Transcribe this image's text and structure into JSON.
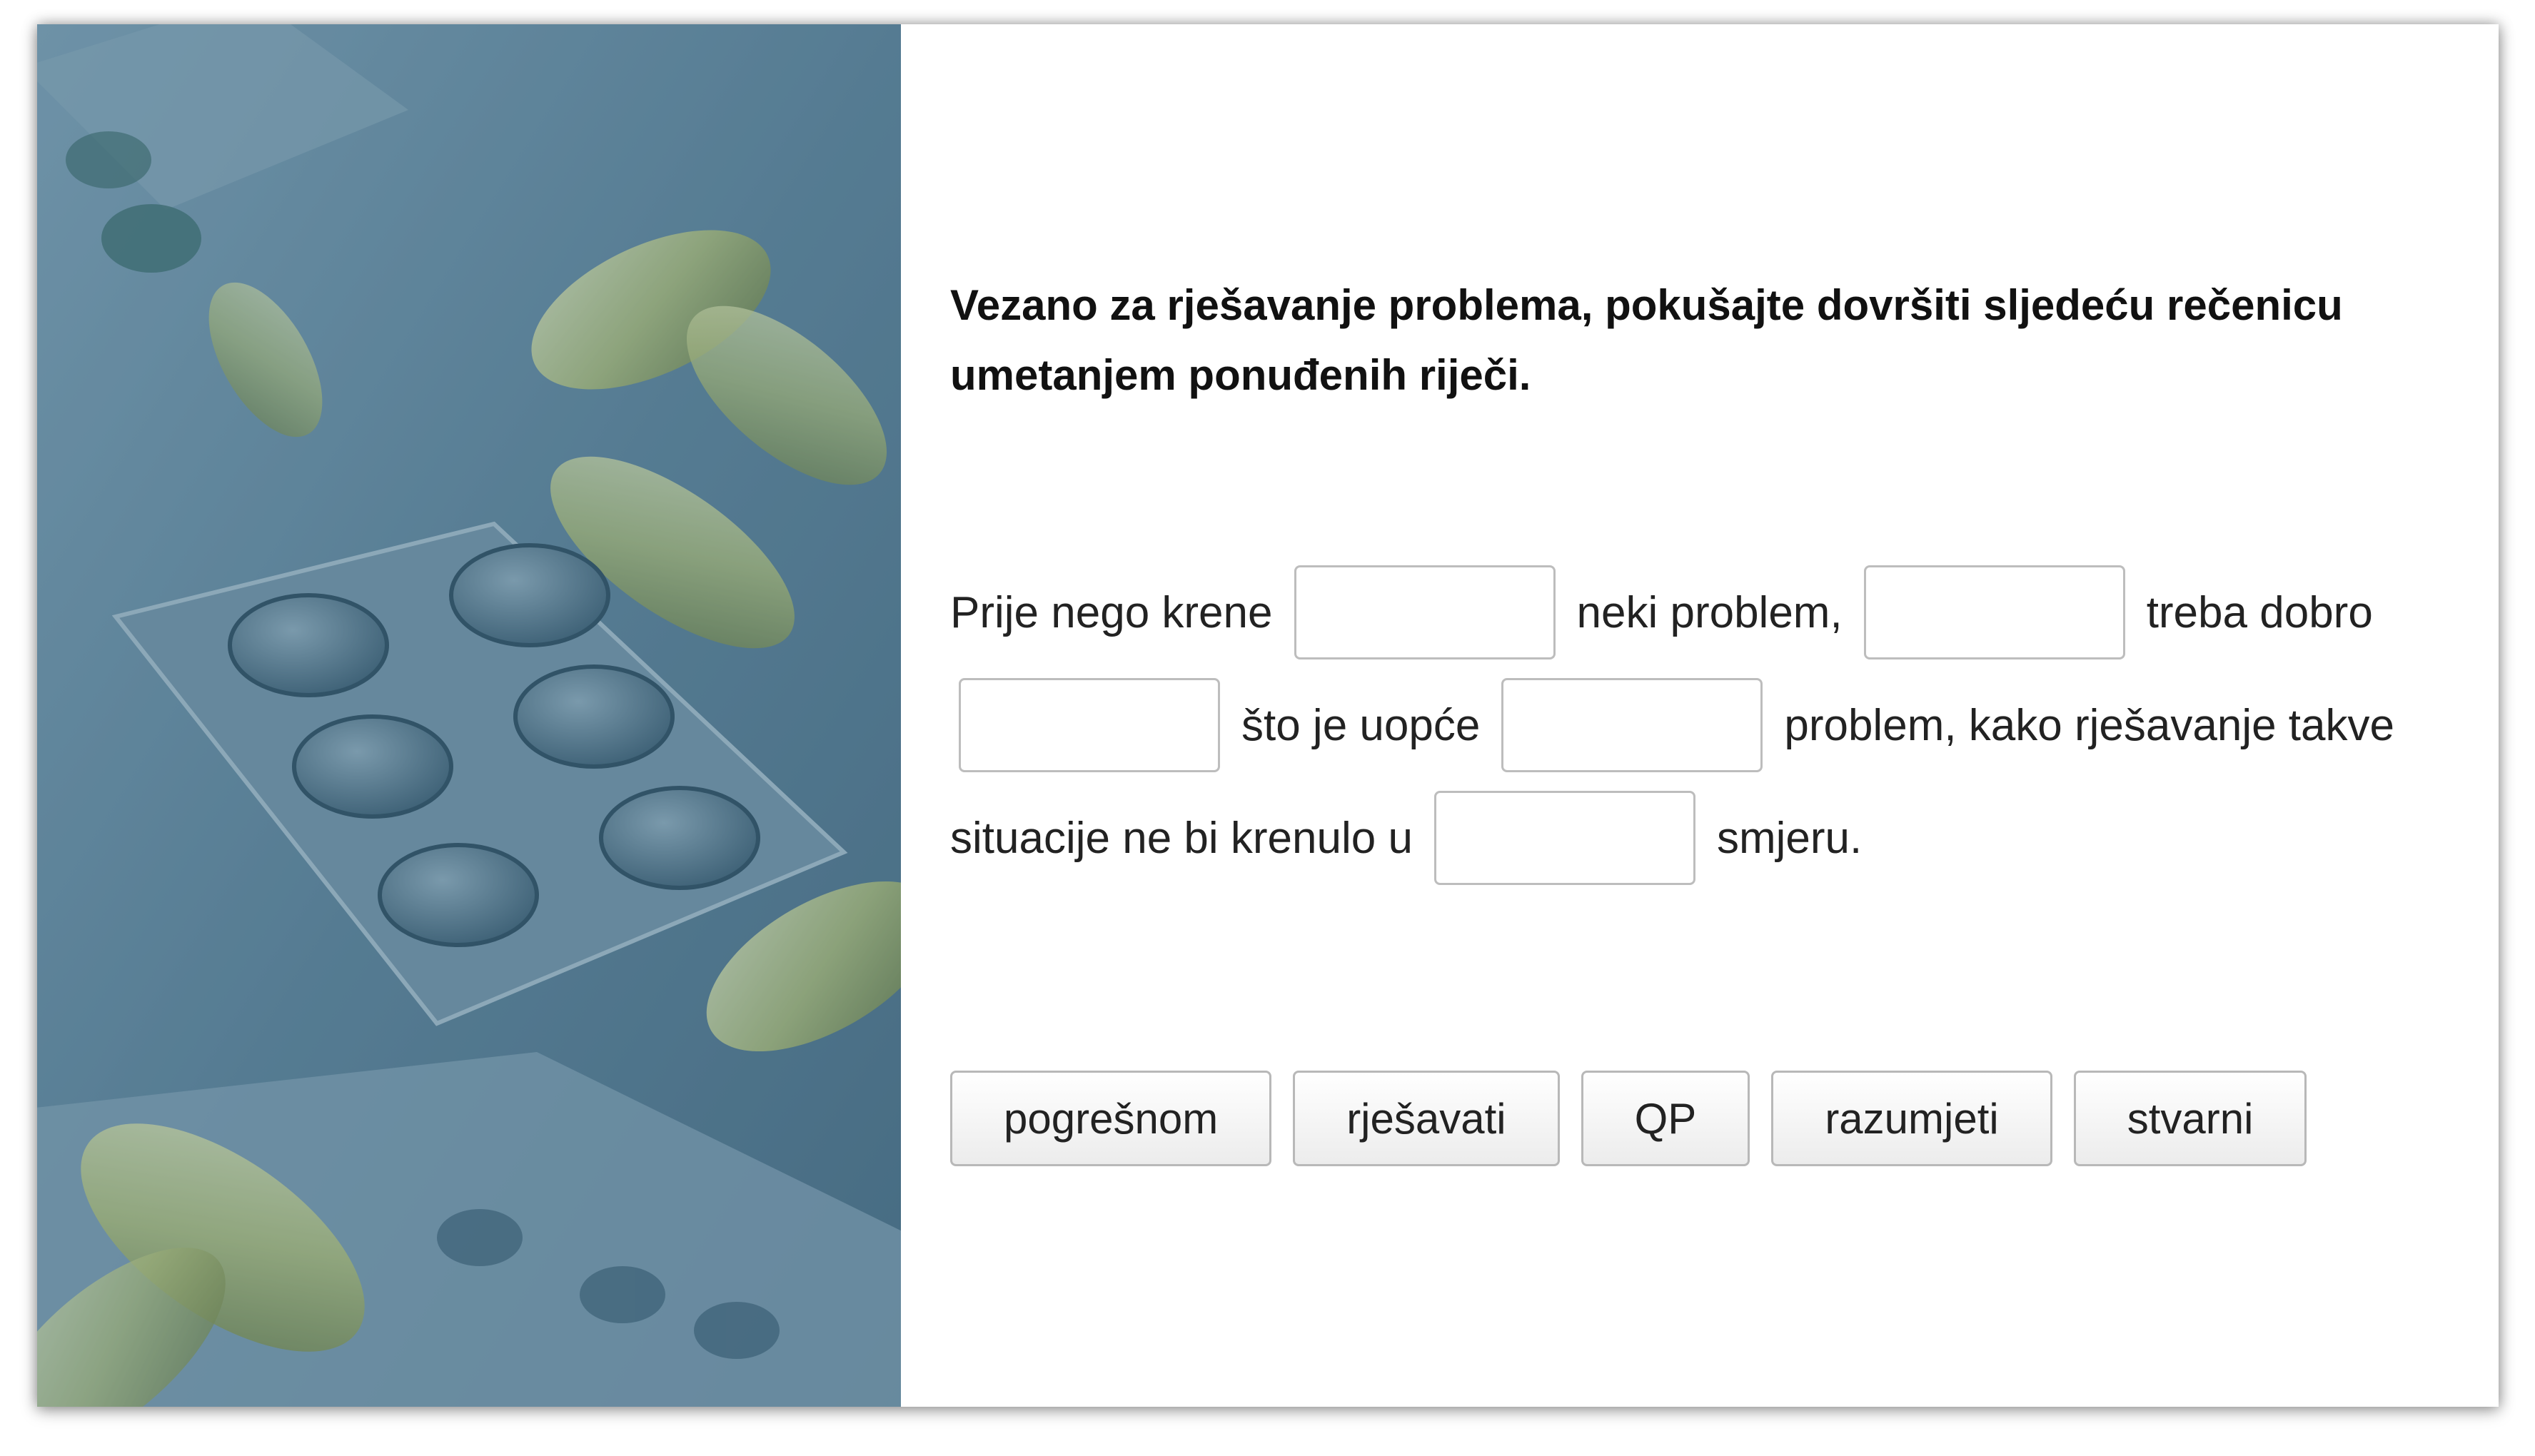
{
  "instruction": "Vezano za rješavanje problema, pokušajte dovršiti sljedeću rečenicu umetanjem ponuđenih riječi.",
  "sentence": {
    "line1": {
      "t1": "Prije nego krene",
      "t2": "neki problem,",
      "t3": "treba dobro"
    },
    "line2": {
      "t1": "što je uopće",
      "t2": "problem, kako rješavanje takve"
    },
    "line3": {
      "t1": "situacije ne bi krenulo u",
      "t2": "smjeru."
    }
  },
  "word_bank": [
    "pogrešnom",
    "rješavati",
    "QP",
    "razumjeti",
    "stvarni"
  ],
  "colors": {
    "photo_tint": "#5b7f96",
    "pill_green": "#b9c27a",
    "blister": "#6f8fa3"
  }
}
